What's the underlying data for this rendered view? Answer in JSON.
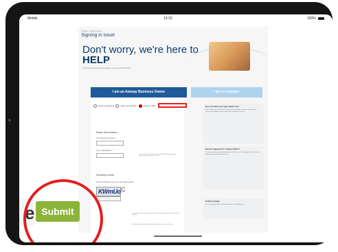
{
  "status_bar": {
    "carrier": "Mobile",
    "time": "10:10",
    "battery": "100%"
  },
  "page": {
    "breadcrumb": "Amway › Signing issue",
    "title_small": "Signing in issue",
    "headline_line1": "Don't worry, we're here to",
    "headline_line2": "HELP",
    "subtext": "If you have lost your account details, you may reset them below."
  },
  "tabs": [
    {
      "label": "I am an Amway Business Owner",
      "active": true
    },
    {
      "label": "I am a customer",
      "active": false
    }
  ],
  "form": {
    "radio_options": [
      "I forgot my password",
      "I forgot my username",
      "I forgot my ABO"
    ],
    "selected_index": 2,
    "basic_info_title": "Basic Information",
    "agreement_label": "Your agreement number *",
    "email_label": "Your e-mail address *",
    "email_help": "This is the e-mail address you provided at the beginning of your Amway Online account.",
    "security_title": "Security check",
    "captcha_prompt": "Type the characters you see in the picture below *",
    "captcha_text": "KWmUo",
    "captcha_input_placeholder": "Enter text from image",
    "refresh_glyph": "C",
    "bottom_line1": "I accept the terms and I agree to be contacted by Amway on my e-mail address.",
    "bottom_line2": "By submitting I confirm that the information above is accurate."
  },
  "sidebar": {
    "box1_title": "Not sure what your login details are?",
    "box1_text": "If you registered your business online, you probably created a username and password for Amway Online during the registration process.",
    "box2_title": "Not yet registered for Amway Online?",
    "box2_text": "To keep in business as Amway Business Owner, you can apply for online access and manage your Amway business.",
    "box3_title": "Contact Amway",
    "box3_text": "We are happy to offer assistance to you. Contact Amway »"
  },
  "buttons": {
    "cancel_peek": "el",
    "submit": "Submit"
  },
  "annotations": {
    "color": "#e21e1e"
  }
}
